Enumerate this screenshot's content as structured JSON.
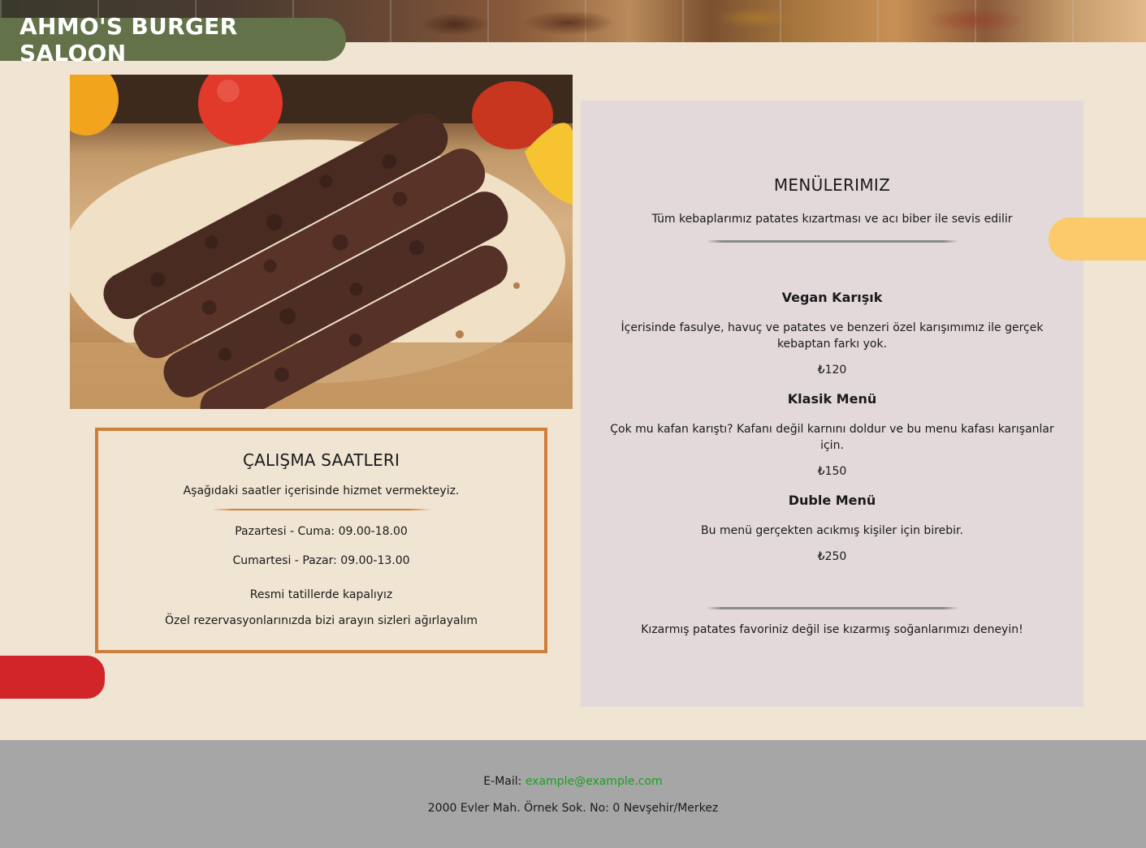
{
  "header": {
    "brand": "AHMO'S BURGER SALOON"
  },
  "hours": {
    "title": "ÇALIŞMA SAATLERI",
    "subtitle": "Aşağıdaki saatler içerisinde hizmet vermekteyiz.",
    "weekdays": "Pazartesi - Cuma: 09.00-18.00",
    "weekend": "Cumartesi - Pazar: 09.00-13.00",
    "holidays": "Resmi tatillerde kapalıyız",
    "reservations": "Özel rezervasyonlarınızda bizi arayın sizleri ağırlayalım"
  },
  "menu": {
    "title": "MENÜLERIMIZ",
    "intro": "Tüm kebaplarımız patates kızartması ve acı biber ile sevis edilir",
    "items": [
      {
        "name": "Vegan Karışık",
        "description": "İçerisinde fasulye, havuç ve patates ve benzeri özel karışımımız ile gerçek kebaptan farkı yok.",
        "price": "₺120"
      },
      {
        "name": "Klasik Menü",
        "description": "Çok mu kafan karıştı? Kafanı değil karnını doldur ve bu menu kafası karışanlar için.",
        "price": "₺150"
      },
      {
        "name": "Duble Menü",
        "description": "Bu menü gerçekten acıkmış kişiler için birebir.",
        "price": "₺250"
      }
    ],
    "outro": "Kızarmış patates favoriniz değil ise kızarmış soğanlarımızı deneyin!"
  },
  "footer": {
    "email_label": "E-Mail:",
    "email": "example@example.com",
    "address": "2000 Evler Mah. Örnek Sok. No: 0 Nevşehir/Merkez"
  },
  "colors": {
    "page_bg": "#f0e4d3",
    "brand_tab": "#637249",
    "hours_border": "#d07f3a",
    "menu_panel": "#e3d9db",
    "accent_red": "#d2252a",
    "accent_yellow": "#fbca6a",
    "footer_bg": "#a6a6a6",
    "link": "#19a01e"
  }
}
